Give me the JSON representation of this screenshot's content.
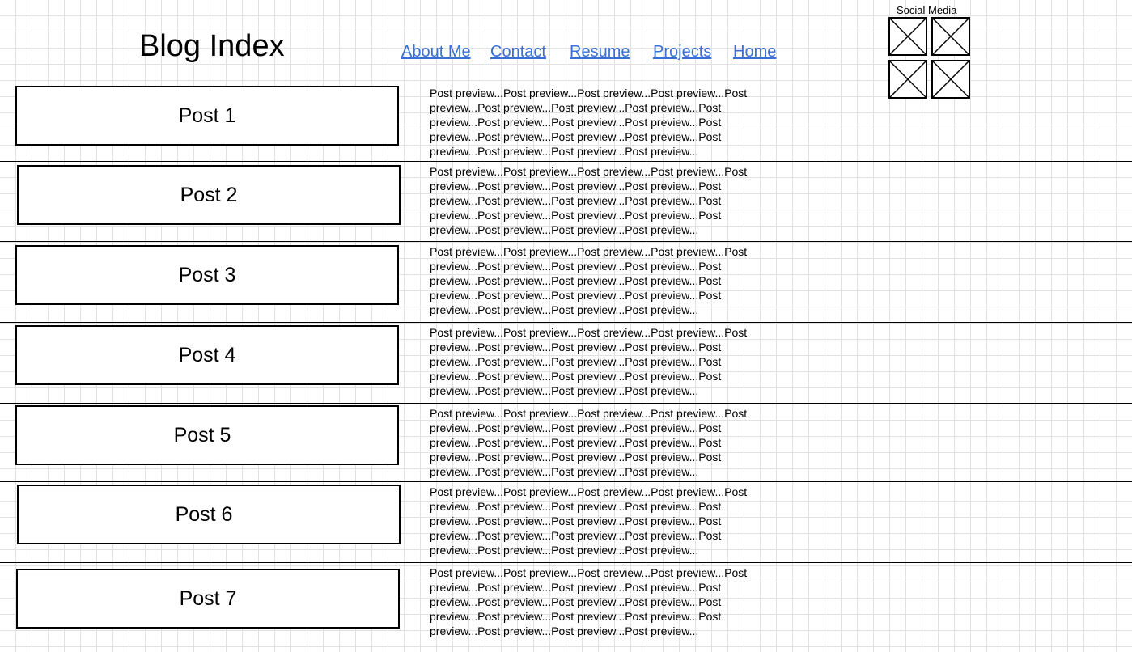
{
  "header": {
    "title": "Blog Index"
  },
  "nav": {
    "items": [
      {
        "label": "About Me"
      },
      {
        "label": "Contact"
      },
      {
        "label": "Resume"
      },
      {
        "label": "Projects"
      },
      {
        "label": "Home"
      }
    ]
  },
  "social": {
    "label": "Social Media",
    "icons": [
      {
        "icon": "image-placeholder-icon"
      },
      {
        "icon": "image-placeholder-icon"
      },
      {
        "icon": "image-placeholder-icon"
      },
      {
        "icon": "image-placeholder-icon"
      }
    ]
  },
  "colors": {
    "link": "#3b6fd6",
    "grid": "#e2e2e2"
  },
  "posts": [
    {
      "title": "Post 1",
      "preview": "Post preview...Post preview...Post preview...Post preview...Post preview...Post preview...Post preview...Post preview...Post preview...Post preview...Post preview...Post preview...Post preview...Post preview...Post preview...Post preview...Post preview...Post preview...Post preview...Post preview..."
    },
    {
      "title": "Post 2",
      "preview": "Post preview...Post preview...Post preview...Post preview...Post preview...Post preview...Post preview...Post preview...Post preview...Post preview...Post preview...Post preview...Post preview...Post preview...Post preview...Post preview...Post preview...Post preview...Post preview...Post preview..."
    },
    {
      "title": "Post 3",
      "preview": "Post preview...Post preview...Post preview...Post preview...Post preview...Post preview...Post preview...Post preview...Post preview...Post preview...Post preview...Post preview...Post preview...Post preview...Post preview...Post preview...Post preview...Post preview...Post preview...Post preview..."
    },
    {
      "title": "Post 4",
      "preview": "Post preview...Post preview...Post preview...Post preview...Post preview...Post preview...Post preview...Post preview...Post preview...Post preview...Post preview...Post preview...Post preview...Post preview...Post preview...Post preview...Post preview...Post preview...Post preview...Post preview..."
    },
    {
      "title": "Post 5",
      "preview": "Post preview...Post preview...Post preview...Post preview...Post preview...Post preview...Post preview...Post preview...Post preview...Post preview...Post preview...Post preview...Post preview...Post preview...Post preview...Post preview...Post preview...Post preview...Post preview...Post preview..."
    },
    {
      "title": "Post 6",
      "preview": "Post preview...Post preview...Post preview...Post preview...Post preview...Post preview...Post preview...Post preview...Post preview...Post preview...Post preview...Post preview...Post preview...Post preview...Post preview...Post preview...Post preview...Post preview...Post preview...Post preview..."
    },
    {
      "title": "Post 7",
      "preview": "Post preview...Post preview...Post preview...Post preview...Post preview...Post preview...Post preview...Post preview...Post preview...Post preview...Post preview...Post preview...Post preview...Post preview...Post preview...Post preview...Post preview...Post preview...Post preview...Post preview..."
    }
  ]
}
